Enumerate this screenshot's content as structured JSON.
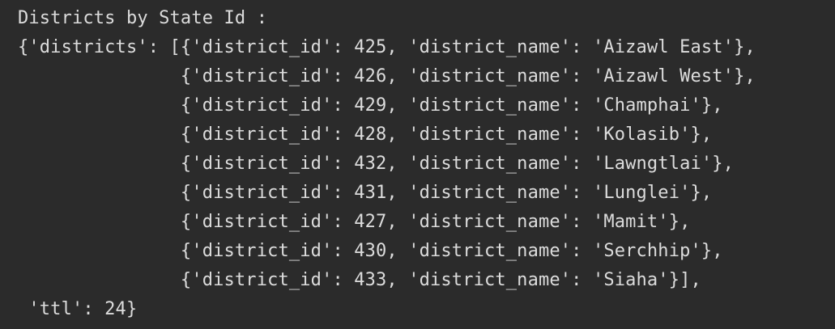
{
  "console": {
    "heading": "Districts by State Id :",
    "lines": [
      "{'districts': [{'district_id': 425, 'district_name': 'Aizawl East'},",
      "               {'district_id': 426, 'district_name': 'Aizawl West'},",
      "               {'district_id': 429, 'district_name': 'Champhai'},",
      "               {'district_id': 428, 'district_name': 'Kolasib'},",
      "               {'district_id': 432, 'district_name': 'Lawngtlai'},",
      "               {'district_id': 431, 'district_name': 'Lunglei'},",
      "               {'district_id': 427, 'district_name': 'Mamit'},",
      "               {'district_id': 430, 'district_name': 'Serchhip'},",
      "               {'district_id': 433, 'district_name': 'Siaha'}],",
      " 'ttl': 24}"
    ]
  }
}
